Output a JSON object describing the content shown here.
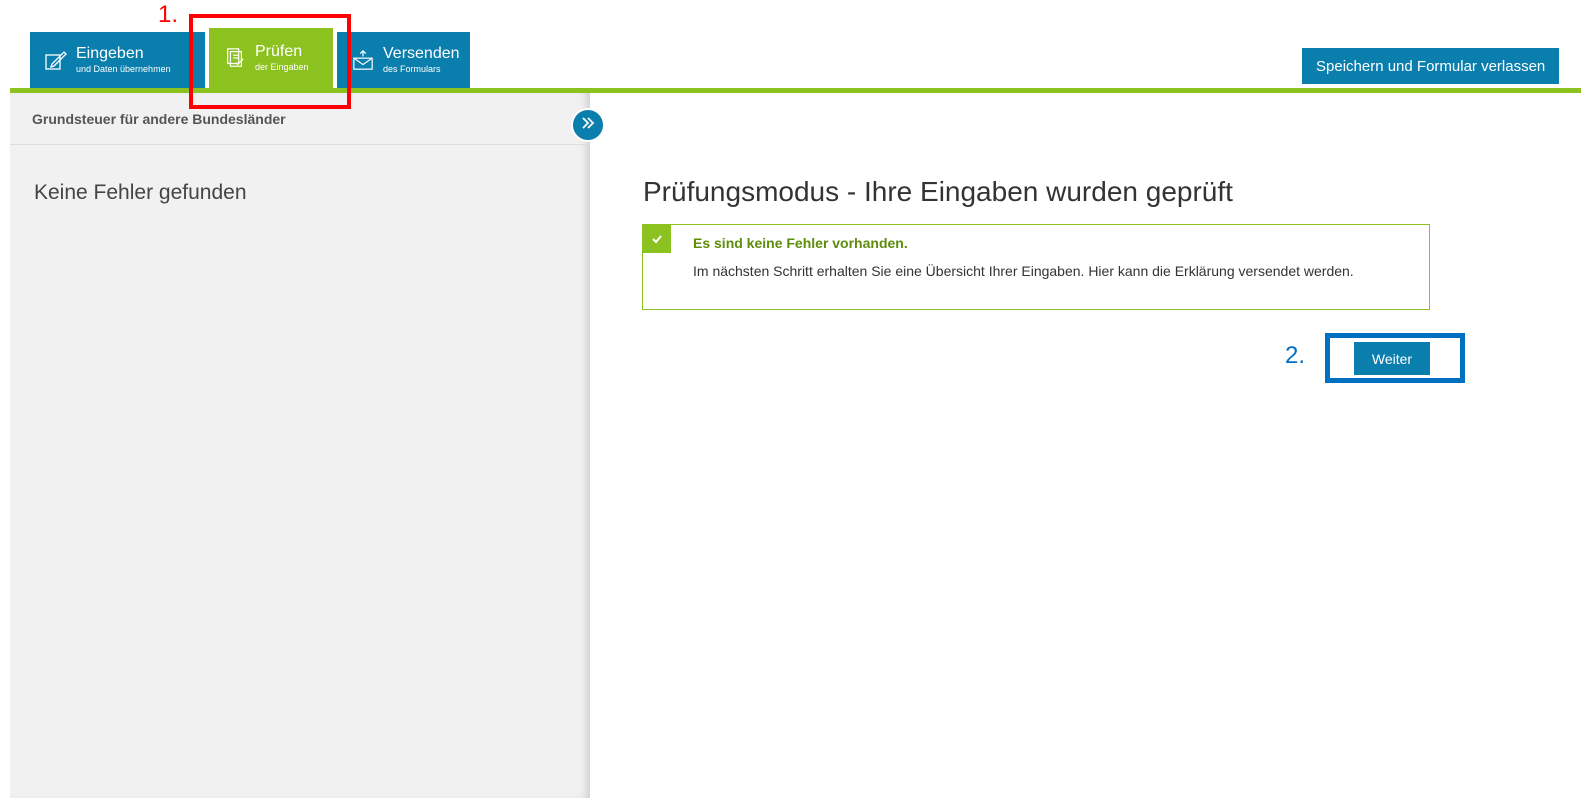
{
  "tabs": [
    {
      "title": "Eingeben",
      "subtitle": "und Daten übernehmen",
      "icon": "edit-icon",
      "color": "#0a7fae"
    },
    {
      "title": "Prüfen",
      "subtitle": "der Eingaben",
      "icon": "checklist-icon",
      "color": "#8cc21f",
      "active": true
    },
    {
      "title": "Versenden",
      "subtitle": "des Formulars",
      "icon": "send-mail-icon",
      "color": "#0a7fae"
    }
  ],
  "header": {
    "save_exit_label": "Speichern und Formular verlassen"
  },
  "sidebar": {
    "title": "Grundsteuer für andere Bundesländer",
    "message": "Keine Fehler gefunden"
  },
  "main": {
    "title": "Prüfungsmodus - Ihre Eingaben wurden geprüft",
    "notice": {
      "title": "Es sind keine Fehler vorhanden.",
      "text": "Im nächsten Schritt erhalten Sie eine Übersicht Ihrer Eingaben. Hier kann die Erklärung versendet werden."
    },
    "next_label": "Weiter"
  },
  "annotations": {
    "step1": "1.",
    "step2": "2."
  },
  "colors": {
    "brand_blue": "#0a7fae",
    "brand_green": "#8cc21f",
    "annotation_red": "#ff0000",
    "annotation_blue": "#0070c0"
  }
}
